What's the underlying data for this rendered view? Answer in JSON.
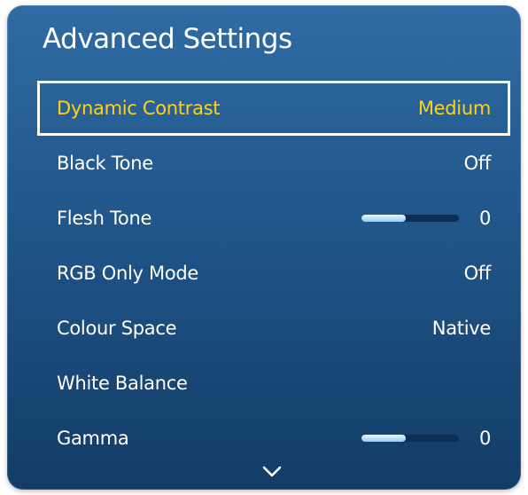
{
  "header": {
    "title": "Advanced Settings"
  },
  "menu": {
    "items": [
      {
        "label": "Dynamic Contrast",
        "value": "Medium",
        "selected": true
      },
      {
        "label": "Black Tone",
        "value": "Off"
      },
      {
        "label": "Flesh Tone",
        "value": "0",
        "slider_level": 0.45
      },
      {
        "label": "RGB Only Mode",
        "value": "Off"
      },
      {
        "label": "Colour Space",
        "value": "Native"
      },
      {
        "label": "White Balance",
        "value": ""
      },
      {
        "label": "Gamma",
        "value": "0",
        "slider_level": 0.45
      }
    ]
  },
  "icons": {
    "scroll_down": "chevron-down-icon"
  },
  "colors": {
    "panel_top": "#2f6ba4",
    "panel_bottom": "#123c66",
    "selected_text": "#ffd21a",
    "text": "#ffffff"
  }
}
